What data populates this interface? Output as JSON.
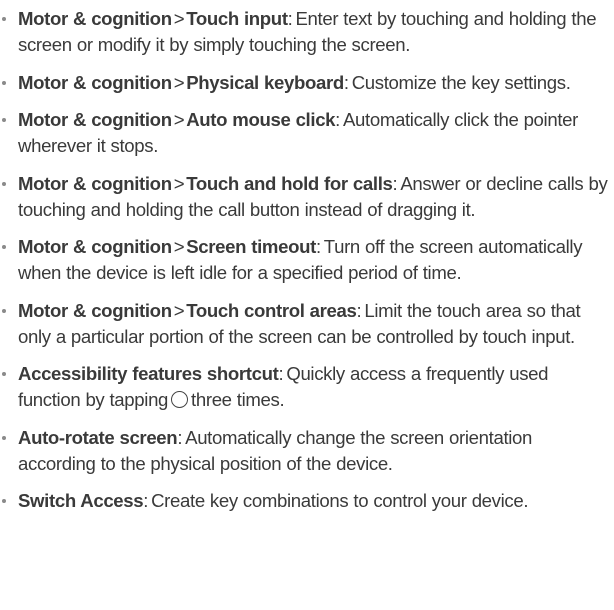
{
  "items": [
    {
      "section": "Motor & cognition",
      "separator": ">",
      "title": "Touch input",
      "colon": ":",
      "description": "Enter text by touching and holding the screen or modify it by simply touching the screen."
    },
    {
      "section": "Motor & cognition",
      "separator": ">",
      "title": "Physical keyboard",
      "colon": ":",
      "description": "Customize the key settings."
    },
    {
      "section": "Motor & cognition",
      "separator": ">",
      "title": "Auto mouse click",
      "colon": ":",
      "description": "Automatically click the pointer wherever it stops."
    },
    {
      "section": "Motor & cognition",
      "separator": ">",
      "title": "Touch and hold for calls",
      "colon": ":",
      "description": "Answer or decline calls by touching and holding the call button instead of dragging it."
    },
    {
      "section": "Motor & cognition",
      "separator": ">",
      "title": "Screen timeout",
      "colon": ":",
      "description": "Turn off the screen automatically when the device is left idle for a specified period of time."
    },
    {
      "section": "Motor & cognition",
      "separator": ">",
      "title": "Touch control areas",
      "colon": ":",
      "description": "Limit the touch area so that only a particular portion of the screen can be controlled by touch input."
    },
    {
      "title": "Accessibility features shortcut",
      "colon": ":",
      "description_before_icon": "Quickly access a frequently used function by tapping",
      "icon": "home-button-icon",
      "description_after_icon": "three times."
    },
    {
      "title": "Auto-rotate screen",
      "colon": ":",
      "description": "Automatically change the screen orientation according to the physical position of the device."
    },
    {
      "title": "Switch Access",
      "colon": ":",
      "description": "Create key combinations to control your device."
    }
  ]
}
